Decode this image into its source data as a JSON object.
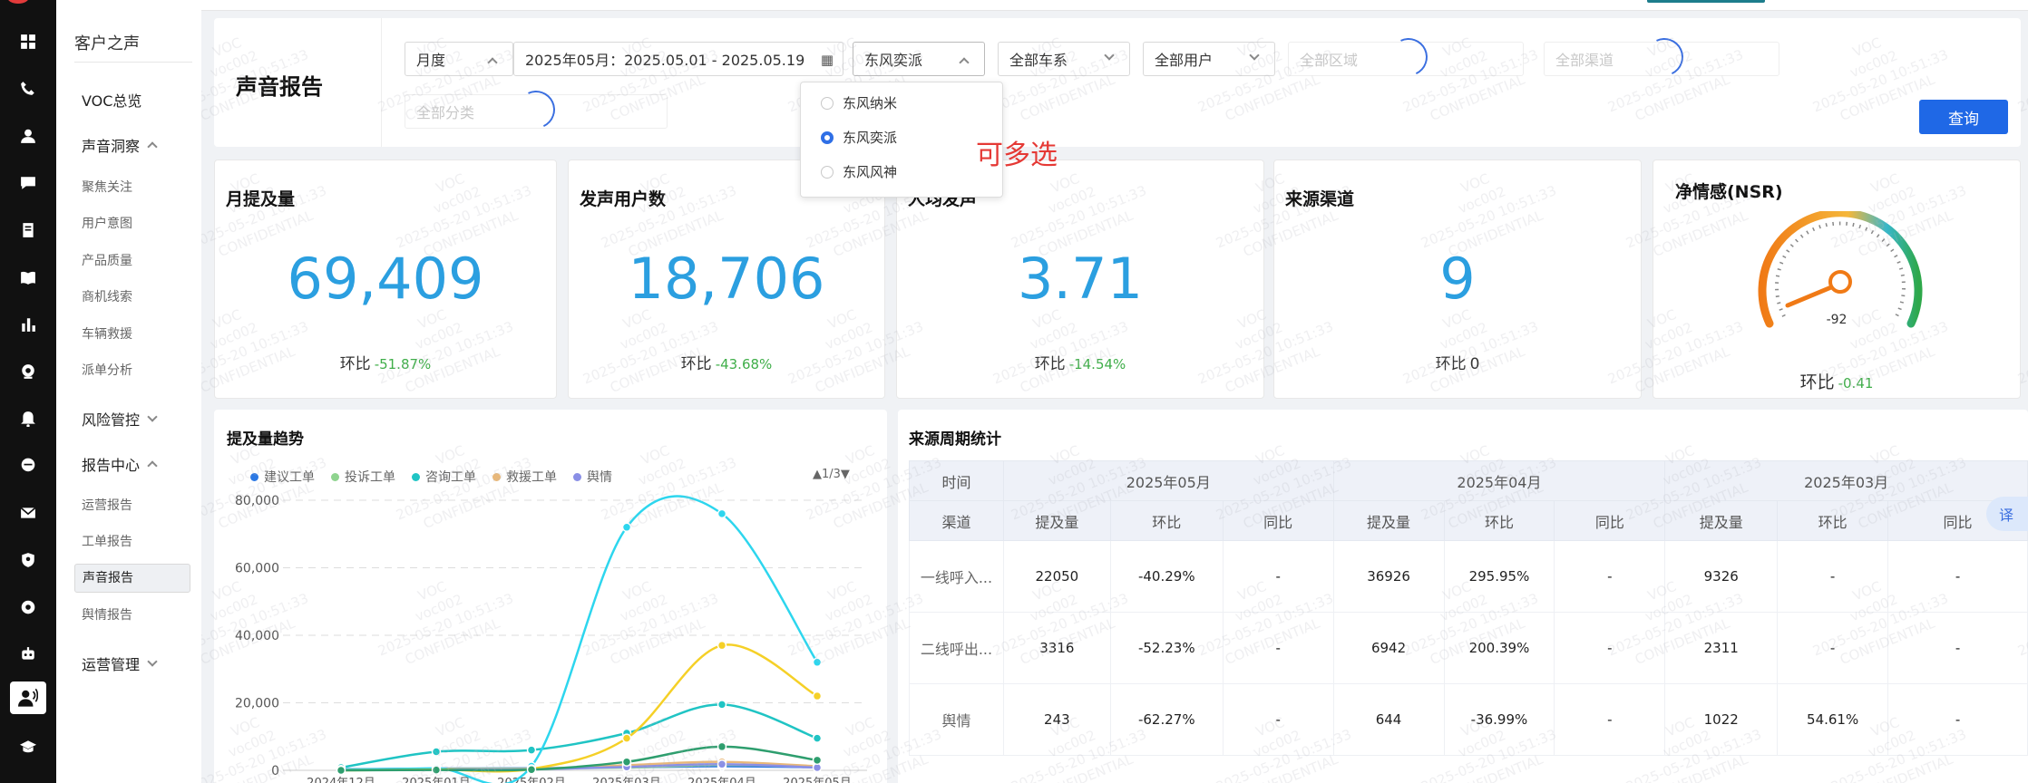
{
  "menu": {
    "title": "客户之声",
    "items": [
      {
        "label": "VOC总览"
      },
      {
        "label": "声音洞察"
      },
      {
        "label": "风险管控"
      },
      {
        "label": "报告中心"
      },
      {
        "label": "运营管理"
      }
    ],
    "insight_subs": [
      "聚焦关注",
      "用户意图",
      "产品质量",
      "商机线索",
      "车辆救援",
      "派单分析"
    ],
    "report_subs": [
      "运营报告",
      "工单报告",
      "声音报告",
      "舆情报告"
    ]
  },
  "filter": {
    "page_title": "声音报告",
    "period": "月度",
    "date_range": "2025年05月：2025.05.01 - 2025.05.19",
    "brand": "东风奕派",
    "series": "全部车系",
    "users": "全部用户",
    "region": "全部区域",
    "channel": "全部渠道",
    "category": "全部分类",
    "query_label": "查询"
  },
  "dropdown": {
    "options": [
      "东风纳米",
      "东风奕派",
      "东风风神"
    ],
    "selected_index": 1,
    "annotation": "可多选"
  },
  "kpis": [
    {
      "title": "月提及量",
      "value": "69,409",
      "ratio_label": "环比",
      "ratio": "-51.87%"
    },
    {
      "title": "发声用户数",
      "value": "18,706",
      "ratio_label": "环比",
      "ratio": "-43.68%"
    },
    {
      "title": "人均发声",
      "value": "3.71",
      "ratio_label": "环比",
      "ratio": "-14.54%"
    },
    {
      "title": "来源渠道",
      "value": "9",
      "ratio_label": "环比",
      "ratio": "0"
    }
  ],
  "nsr": {
    "title": "净情感(NSR)",
    "value": "-92",
    "ratio_label": "环比",
    "ratio": "-0.41"
  },
  "trend": {
    "title": "提及量趋势",
    "pager": "▲1/3▼",
    "x_labels": [
      "2024年12月",
      "2025年01月",
      "2025年02月",
      "2025年03月",
      "2025年04月",
      "2025年05月"
    ]
  },
  "chart_data": {
    "type": "line",
    "x": [
      "2024年12月",
      "2025年01月",
      "2025年02月",
      "2025年03月",
      "2025年04月",
      "2025年05月"
    ],
    "ylim": [
      0,
      80000
    ],
    "y_ticks": [
      0,
      20000,
      40000,
      60000,
      80000
    ],
    "y_tick_labels": [
      "0",
      "20,000",
      "40,000",
      "60,000",
      "80,000"
    ],
    "grid": true,
    "series": [
      {
        "name": "建议工单",
        "color": "#2b78e4",
        "values": [
          300,
          500,
          600,
          900,
          1200,
          900
        ]
      },
      {
        "name": "投诉工单",
        "color": "#8fd48f",
        "values": [
          200,
          400,
          500,
          800,
          1600,
          1000
        ]
      },
      {
        "name": "咨询工单",
        "color": "#20c4c4",
        "values": [
          800,
          5500,
          6000,
          11000,
          19500,
          9500
        ]
      },
      {
        "name": "救援工单",
        "color": "#e8b87a",
        "values": [
          100,
          300,
          400,
          1500,
          2500,
          1200
        ]
      },
      {
        "name": "舆情",
        "color": "#8a8fe6",
        "values": [
          100,
          200,
          300,
          1000,
          1800,
          800
        ]
      },
      {
        "name": "",
        "color": "#2dd6ee",
        "values": [
          200,
          600,
          1200,
          72000,
          76000,
          32000
        ]
      },
      {
        "name": "",
        "color": "#f5d027",
        "values": [
          0,
          200,
          400,
          9500,
          37000,
          22000
        ]
      },
      {
        "name": "",
        "color": "#2e9e6e",
        "values": [
          0,
          100,
          200,
          2500,
          7000,
          3000
        ]
      }
    ]
  },
  "source": {
    "title": "来源周期统计",
    "time_label": "时间",
    "channel_label": "渠道",
    "months": [
      "2025年05月",
      "2025年04月",
      "2025年03月"
    ],
    "subheads": [
      "提及量",
      "环比",
      "同比"
    ],
    "rows": [
      {
        "channel": "一线呼入...",
        "cells": [
          "22050",
          "-40.29%",
          "-",
          "36926",
          "295.95%",
          "-",
          "9326",
          "-",
          "-"
        ]
      },
      {
        "channel": "二线呼出...",
        "cells": [
          "3316",
          "-52.23%",
          "-",
          "6942",
          "200.39%",
          "-",
          "2311",
          "-",
          "-"
        ]
      },
      {
        "channel": "舆情",
        "cells": [
          "243",
          "-62.27%",
          "-",
          "644",
          "-36.99%",
          "-",
          "1022",
          "54.61%",
          "-"
        ]
      }
    ]
  },
  "translate_label": "译",
  "watermark": {
    "line1": "VOC",
    "line2": "voc002",
    "line3": "2025-05-20 10:51:33",
    "line4": "CONFIDENTIAL"
  }
}
